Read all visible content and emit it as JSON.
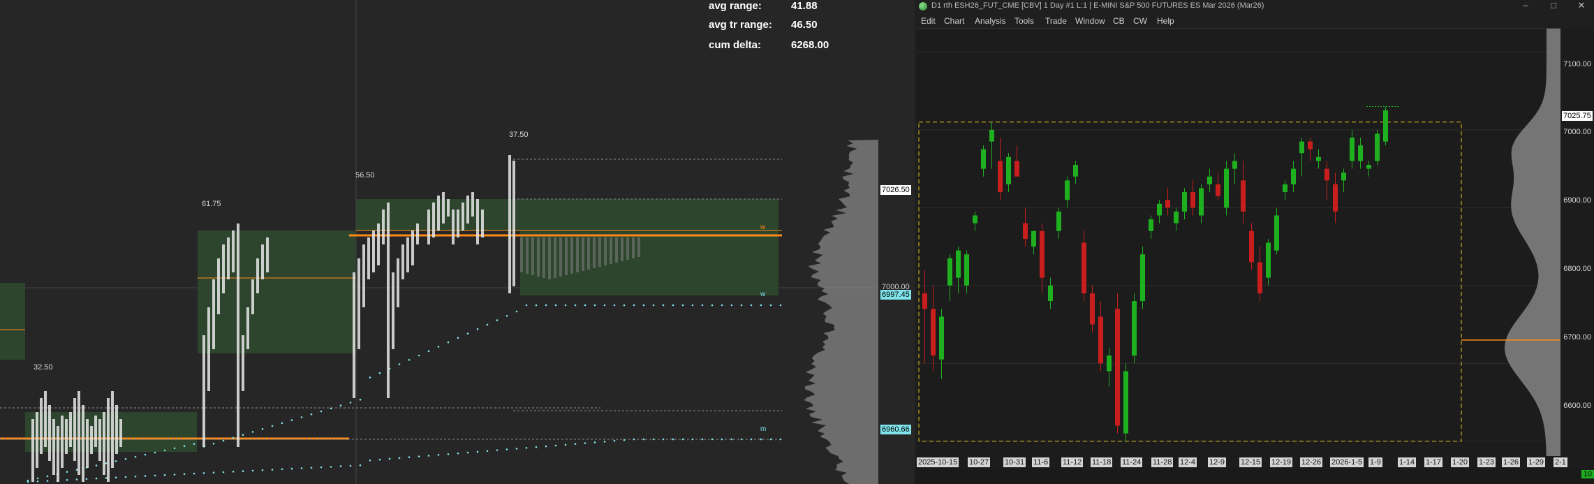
{
  "left_panel": {
    "stats": [
      {
        "label": "avg range:",
        "value": "41.88"
      },
      {
        "label": "avg tr range:",
        "value": "46.50"
      },
      {
        "label": "cum delta:",
        "value": "6268.00"
      }
    ],
    "range_labels": [
      "32.50",
      "61.75",
      "56.50",
      "37.50"
    ],
    "line_markers": [
      "w",
      "w",
      "m"
    ],
    "price_axis": {
      "tags": [
        {
          "text": "7026.50",
          "bg": "#ffffff",
          "fg": "#000000"
        },
        {
          "text": "7000.00",
          "bg": "#262626",
          "fg": "#cfcfcf"
        },
        {
          "text": "6997.45",
          "bg": "#7fe3ea",
          "fg": "#000000"
        },
        {
          "text": "6960.66",
          "bg": "#7fe3ea",
          "fg": "#000000"
        }
      ]
    },
    "colors": {
      "orange": "#ff8c1a",
      "value_area": "#2f4a2f",
      "vwap_dots": "#7fe3ea",
      "profile": "#8c8c8c"
    }
  },
  "right_window": {
    "title": "D1 rth ESH26_FUT_CME [CBV]  1 Day  #1 L:1 | E-MINI S&P 500 FUTURES ES Mar 2026 (Mar26)",
    "window_controls": [
      "–",
      "□",
      "✕"
    ],
    "menu": [
      "Edit",
      "Chart",
      "Analysis",
      "Tools",
      "Trade",
      "Window",
      "CB",
      "CW",
      "Help"
    ],
    "price_axis": {
      "labels": [
        "7100.00",
        "7025.75",
        "7000.00",
        "6900.00",
        "6800.00",
        "6700.00",
        "6600.00"
      ],
      "current_price": "7025.75"
    },
    "date_axis": [
      "2025-10-15",
      "10-27",
      "10-31",
      "11-6",
      "11-12",
      "11-18",
      "11-24",
      "11-28",
      "12-4",
      "12-9",
      "12-15",
      "12-19",
      "12-26",
      "2026-1-5",
      "1-9",
      "1-14",
      "1-17",
      "1-20",
      "1-23",
      "1-26",
      "1-29",
      "2-1"
    ],
    "corner_label": "10",
    "colors": {
      "bull": "#1fb01f",
      "bear": "#c81e1e",
      "box": "#e6c619",
      "poc": "#ff8c1a",
      "profile": "#8c8c8c"
    }
  },
  "chart_data": {
    "type": "candlestick",
    "ylim": [
      6580,
      7130
    ],
    "candles": [
      {
        "o": 6790,
        "h": 6820,
        "l": 6700,
        "c": 6770
      },
      {
        "o": 6770,
        "h": 6800,
        "l": 6690,
        "c": 6710
      },
      {
        "o": 6705,
        "h": 6770,
        "l": 6680,
        "c": 6760
      },
      {
        "o": 6800,
        "h": 6840,
        "l": 6780,
        "c": 6835
      },
      {
        "o": 6810,
        "h": 6850,
        "l": 6790,
        "c": 6845
      },
      {
        "o": 6800,
        "h": 6845,
        "l": 6790,
        "c": 6840
      },
      {
        "o": 6880,
        "h": 6895,
        "l": 6870,
        "c": 6890
      },
      {
        "o": 6950,
        "h": 6980,
        "l": 6940,
        "c": 6975
      },
      {
        "o": 6985,
        "h": 7010,
        "l": 6950,
        "c": 7000
      },
      {
        "o": 6960,
        "h": 6990,
        "l": 6910,
        "c": 6920
      },
      {
        "o": 6930,
        "h": 6970,
        "l": 6920,
        "c": 6965
      },
      {
        "o": 6960,
        "h": 6980,
        "l": 6940,
        "c": 6940
      },
      {
        "o": 6880,
        "h": 6900,
        "l": 6850,
        "c": 6860
      },
      {
        "o": 6850,
        "h": 6870,
        "l": 6840,
        "c": 6870
      },
      {
        "o": 6870,
        "h": 6880,
        "l": 6790,
        "c": 6810
      },
      {
        "o": 6780,
        "h": 6810,
        "l": 6770,
        "c": 6800
      },
      {
        "o": 6870,
        "h": 6900,
        "l": 6860,
        "c": 6895
      },
      {
        "o": 6910,
        "h": 6940,
        "l": 6900,
        "c": 6935
      },
      {
        "o": 6940,
        "h": 6960,
        "l": 6930,
        "c": 6955
      },
      {
        "o": 6855,
        "h": 6870,
        "l": 6780,
        "c": 6790
      },
      {
        "o": 6790,
        "h": 6800,
        "l": 6740,
        "c": 6750
      },
      {
        "o": 6760,
        "h": 6780,
        "l": 6690,
        "c": 6700
      },
      {
        "o": 6690,
        "h": 6720,
        "l": 6670,
        "c": 6710
      },
      {
        "o": 6770,
        "h": 6790,
        "l": 6610,
        "c": 6620
      },
      {
        "o": 6610,
        "h": 6700,
        "l": 6600,
        "c": 6690
      },
      {
        "o": 6710,
        "h": 6790,
        "l": 6700,
        "c": 6780
      },
      {
        "o": 6780,
        "h": 6850,
        "l": 6770,
        "c": 6840
      },
      {
        "o": 6870,
        "h": 6890,
        "l": 6860,
        "c": 6885
      },
      {
        "o": 6890,
        "h": 6910,
        "l": 6880,
        "c": 6905
      },
      {
        "o": 6910,
        "h": 6925,
        "l": 6890,
        "c": 6900
      },
      {
        "o": 6880,
        "h": 6900,
        "l": 6870,
        "c": 6895
      },
      {
        "o": 6895,
        "h": 6925,
        "l": 6885,
        "c": 6920
      },
      {
        "o": 6920,
        "h": 6935,
        "l": 6890,
        "c": 6900
      },
      {
        "o": 6890,
        "h": 6930,
        "l": 6880,
        "c": 6925
      },
      {
        "o": 6930,
        "h": 6950,
        "l": 6920,
        "c": 6940
      },
      {
        "o": 6930,
        "h": 6945,
        "l": 6910,
        "c": 6915
      },
      {
        "o": 6900,
        "h": 6960,
        "l": 6890,
        "c": 6950
      },
      {
        "o": 6950,
        "h": 6970,
        "l": 6930,
        "c": 6960
      },
      {
        "o": 6935,
        "h": 6960,
        "l": 6880,
        "c": 6895
      },
      {
        "o": 6870,
        "h": 6880,
        "l": 6820,
        "c": 6830
      },
      {
        "o": 6830,
        "h": 6850,
        "l": 6780,
        "c": 6790
      },
      {
        "o": 6810,
        "h": 6860,
        "l": 6800,
        "c": 6855
      },
      {
        "o": 6845,
        "h": 6900,
        "l": 6840,
        "c": 6890
      },
      {
        "o": 6920,
        "h": 6935,
        "l": 6910,
        "c": 6930
      },
      {
        "o": 6930,
        "h": 6960,
        "l": 6920,
        "c": 6950
      },
      {
        "o": 6970,
        "h": 6990,
        "l": 6940,
        "c": 6985
      },
      {
        "o": 6985,
        "h": 6990,
        "l": 6960,
        "c": 6975
      },
      {
        "o": 6960,
        "h": 6975,
        "l": 6950,
        "c": 6965
      },
      {
        "o": 6950,
        "h": 6960,
        "l": 6910,
        "c": 6935
      },
      {
        "o": 6930,
        "h": 6945,
        "l": 6880,
        "c": 6895
      },
      {
        "o": 6935,
        "h": 6950,
        "l": 6920,
        "c": 6945
      },
      {
        "o": 6960,
        "h": 7000,
        "l": 6950,
        "c": 6990
      },
      {
        "o": 6960,
        "h": 6990,
        "l": 6950,
        "c": 6980
      },
      {
        "o": 6950,
        "h": 6960,
        "l": 6940,
        "c": 6955
      },
      {
        "o": 6960,
        "h": 7000,
        "l": 6955,
        "c": 6995
      },
      {
        "o": 6985,
        "h": 7030,
        "l": 6980,
        "c": 7025
      }
    ]
  }
}
